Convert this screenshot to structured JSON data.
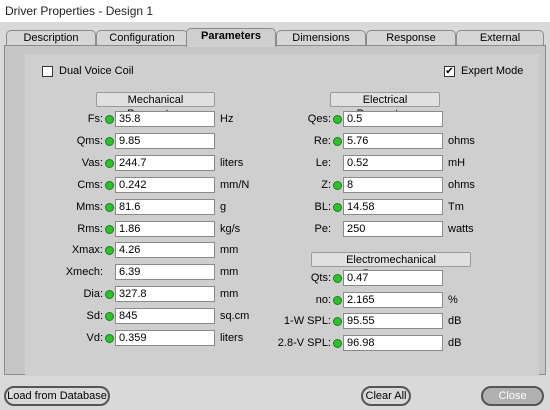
{
  "window": {
    "title": "Driver Properties - Design 1"
  },
  "tabs": [
    {
      "label": "Description"
    },
    {
      "label": "Configuration"
    },
    {
      "label": "Parameters"
    },
    {
      "label": "Dimensions"
    },
    {
      "label": "Response"
    },
    {
      "label": "External"
    }
  ],
  "active_tab": "Parameters",
  "options": {
    "dual_voice_coil": {
      "label": "Dual Voice Coil",
      "checked": false
    },
    "expert_mode": {
      "label": "Expert Mode",
      "checked": true,
      "mark": "✔"
    }
  },
  "mechanical": {
    "heading": "Mechanical Parameters",
    "rows": [
      {
        "label": "Fs:",
        "value": "35.8",
        "unit": "Hz",
        "led": true
      },
      {
        "label": "Qms:",
        "value": "9.85",
        "unit": "",
        "led": true
      },
      {
        "label": "Vas:",
        "value": "244.7",
        "unit": "liters",
        "led": true
      },
      {
        "label": "Cms:",
        "value": "0.242",
        "unit": "mm/N",
        "led": true
      },
      {
        "label": "Mms:",
        "value": "81.6",
        "unit": "g",
        "led": true
      },
      {
        "label": "Rms:",
        "value": "1.86",
        "unit": "kg/s",
        "led": true
      },
      {
        "label": "Xmax:",
        "value": "4.26",
        "unit": "mm",
        "led": true
      },
      {
        "label": "Xmech:",
        "value": "6.39",
        "unit": "mm",
        "led": false
      },
      {
        "label": "Dia:",
        "value": "327.8",
        "unit": "mm",
        "led": true
      },
      {
        "label": "Sd:",
        "value": "845",
        "unit": "sq.cm",
        "led": true
      },
      {
        "label": "Vd:",
        "value": "0.359",
        "unit": "liters",
        "led": true
      }
    ]
  },
  "electrical": {
    "heading": "Electrical Parameters",
    "rows": [
      {
        "label": "Qes:",
        "value": "0.5",
        "unit": "",
        "led": true
      },
      {
        "label": "Re:",
        "value": "5.76",
        "unit": "ohms",
        "led": true
      },
      {
        "label": "Le:",
        "value": "0.52",
        "unit": "mH",
        "led": false
      },
      {
        "label": "Z:",
        "value": "8",
        "unit": "ohms",
        "led": true
      },
      {
        "label": "BL:",
        "value": "14.58",
        "unit": "Tm",
        "led": true
      },
      {
        "label": "Pe:",
        "value": "250",
        "unit": "watts",
        "led": false
      }
    ]
  },
  "electromechanical": {
    "heading": "Electromechanical Parameters",
    "rows": [
      {
        "label": "Qts:",
        "value": "0.47",
        "unit": "",
        "led": true
      },
      {
        "label": "no:",
        "value": "2.165",
        "unit": "%",
        "led": true
      },
      {
        "label": "1-W SPL:",
        "value": "95.55",
        "unit": "dB",
        "led": true
      },
      {
        "label": "2.8-V SPL:",
        "value": "96.98",
        "unit": "dB",
        "led": true
      }
    ]
  },
  "buttons": {
    "load": "Load from Database",
    "clear": "Clear All",
    "close": "Close"
  },
  "colors": {
    "led_on": "#2fbf2f"
  }
}
